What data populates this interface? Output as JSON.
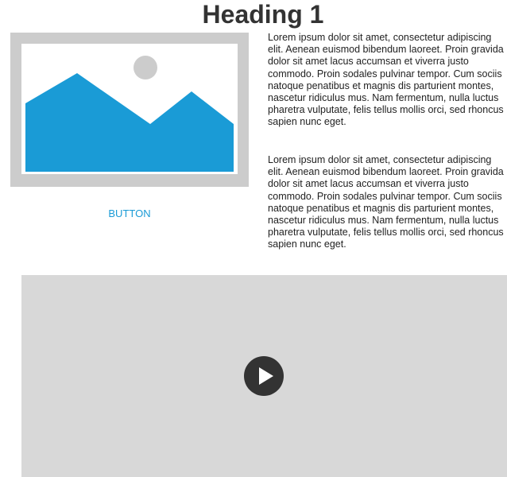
{
  "heading": "Heading 1",
  "image": {
    "icon": "image-placeholder-icon",
    "frame_color": "#cccccc",
    "mountain_color": "#1a9bd6",
    "sun_color": "#cccccc"
  },
  "button": {
    "label": "BUTTON",
    "color": "#1a9bd6"
  },
  "paragraphs": [
    "Lorem ipsum dolor sit amet, consectetur adipiscing elit. Aenean euismod bibendum laoreet. Proin gravida dolor sit amet lacus accumsan et viverra justo commodo. Proin sodales pulvinar tempor. Cum sociis natoque penatibus et magnis dis parturient montes, nascetur ridiculus mus. Nam fermentum, nulla luctus pharetra vulputate, felis tellus mollis orci, sed rhoncus sapien nunc eget.",
    "Lorem ipsum dolor sit amet, consectetur adipiscing elit. Aenean euismod bibendum laoreet. Proin gravida dolor sit amet lacus accumsan et viverra justo commodo. Proin sodales pulvinar tempor. Cum sociis natoque penatibus et magnis dis parturient montes, nascetur ridiculus mus. Nam fermentum, nulla luctus pharetra vulputate, felis tellus mollis orci, sed rhoncus sapien nunc eget."
  ],
  "video": {
    "icon": "play-icon",
    "background": "#d8d8d8",
    "play_color": "#333333"
  }
}
